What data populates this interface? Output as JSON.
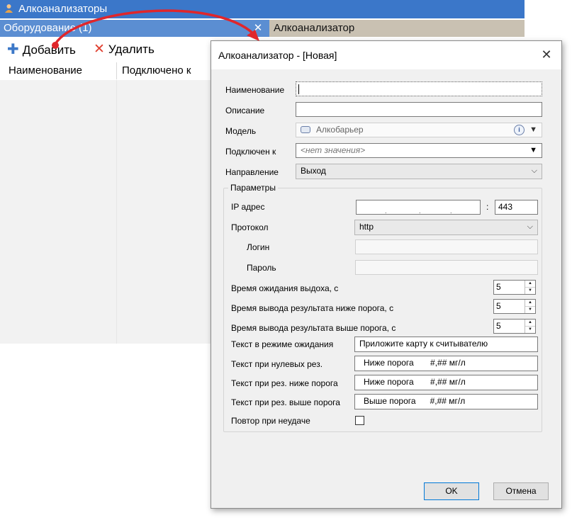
{
  "app": {
    "title": "Алкоанализаторы",
    "equipment_header": "Оборудование (1)",
    "close_glyph": "✕",
    "right_header": "Алкоанализатор",
    "toolbar": {
      "add_label": "Добавить",
      "delete_label": "Удалить"
    },
    "grid": {
      "columns": [
        "Наименование",
        "Подключено к"
      ]
    }
  },
  "dialog": {
    "title": "Алкоанализатор -  [Новая]",
    "close_glyph": "✕",
    "fields": {
      "name_label": "Наименование",
      "name_value": "",
      "description_label": "Описание",
      "description_value": "",
      "model_label": "Модель",
      "model_value": "Алкобарьер",
      "connected_label": "Подключен к",
      "connected_value": "<нет значения>",
      "direction_label": "Направление",
      "direction_value": "Выход"
    },
    "params": {
      "legend": "Параметры",
      "ip_label": "IP адрес",
      "ip_value": "",
      "port_separator": ":",
      "port_value": "443",
      "protocol_label": "Протокол",
      "protocol_value": "http",
      "login_label": "Логин",
      "login_value": "",
      "password_label": "Пароль",
      "password_value": "",
      "exhale_wait_label": "Время ожидания выдоха, с",
      "exhale_wait_value": "5",
      "below_time_label": "Время вывода результата ниже порога, с",
      "below_time_value": "5",
      "above_time_label": "Время вывода результата выше порога, с",
      "above_time_value": "5",
      "idle_text_label": "Текст в режиме ожидания",
      "idle_text_value": "Приложите карту  к считывателю",
      "zero_text_label": "Текст при нулевых рез.",
      "zero_text_value": "Ниже порога       #,## мг/л",
      "below_text_label": "Текст при рез. ниже порога",
      "below_text_value": "Ниже порога       #,## мг/л",
      "above_text_label": "Текст при рез. выше порога",
      "above_text_value": "Выше порога      #,## мг/л",
      "retry_label": "Повтор при неудаче",
      "retry_checked": false
    },
    "buttons": {
      "ok": "OK",
      "cancel": "Отмена"
    }
  },
  "colors": {
    "title_bar": "#3b77c9",
    "equipment_header": "#5b8ed2",
    "right_header": "#c9c1b2",
    "annotation": "#e0262b"
  },
  "icons": [
    "user-group-icon",
    "close-icon",
    "add-icon",
    "delete-icon",
    "info-icon",
    "chevron-down-icon",
    "spin-up-icon",
    "spin-down-icon"
  ]
}
